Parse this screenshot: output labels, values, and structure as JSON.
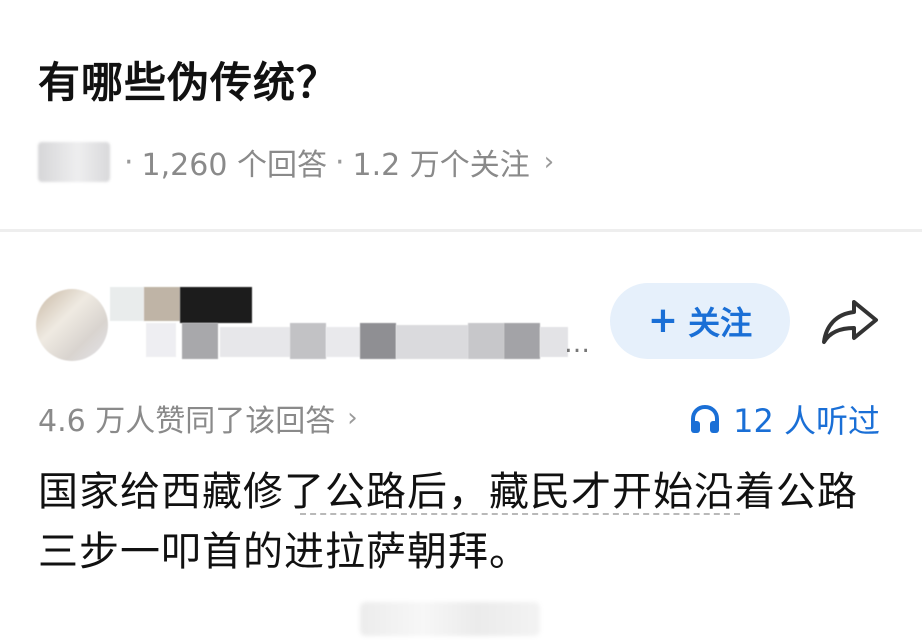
{
  "question": {
    "title": "有哪些伪传统？",
    "answers_count": "1,260 个回答",
    "followers": "1.2 万个关注",
    "separator": "·",
    "chevron": "›"
  },
  "author": {
    "follow_plus": "+",
    "follow_label": "关注",
    "share_icon": "share-arrow-icon",
    "ellipsis": "…"
  },
  "answer": {
    "upvotes": "4.6 万人赞同了该回答",
    "chevron": "›",
    "listen_icon": "headphones-icon",
    "listen_count": "12 人听过",
    "text": "国家给西藏修了公路后，藏民才开始沿着公路三步一叩首的进拉萨朝拜。"
  },
  "colors": {
    "accent": "#1a6fd6",
    "follow_bg": "#e6f0fb",
    "meta_text": "#8a8a8a",
    "title_text": "#111111"
  }
}
